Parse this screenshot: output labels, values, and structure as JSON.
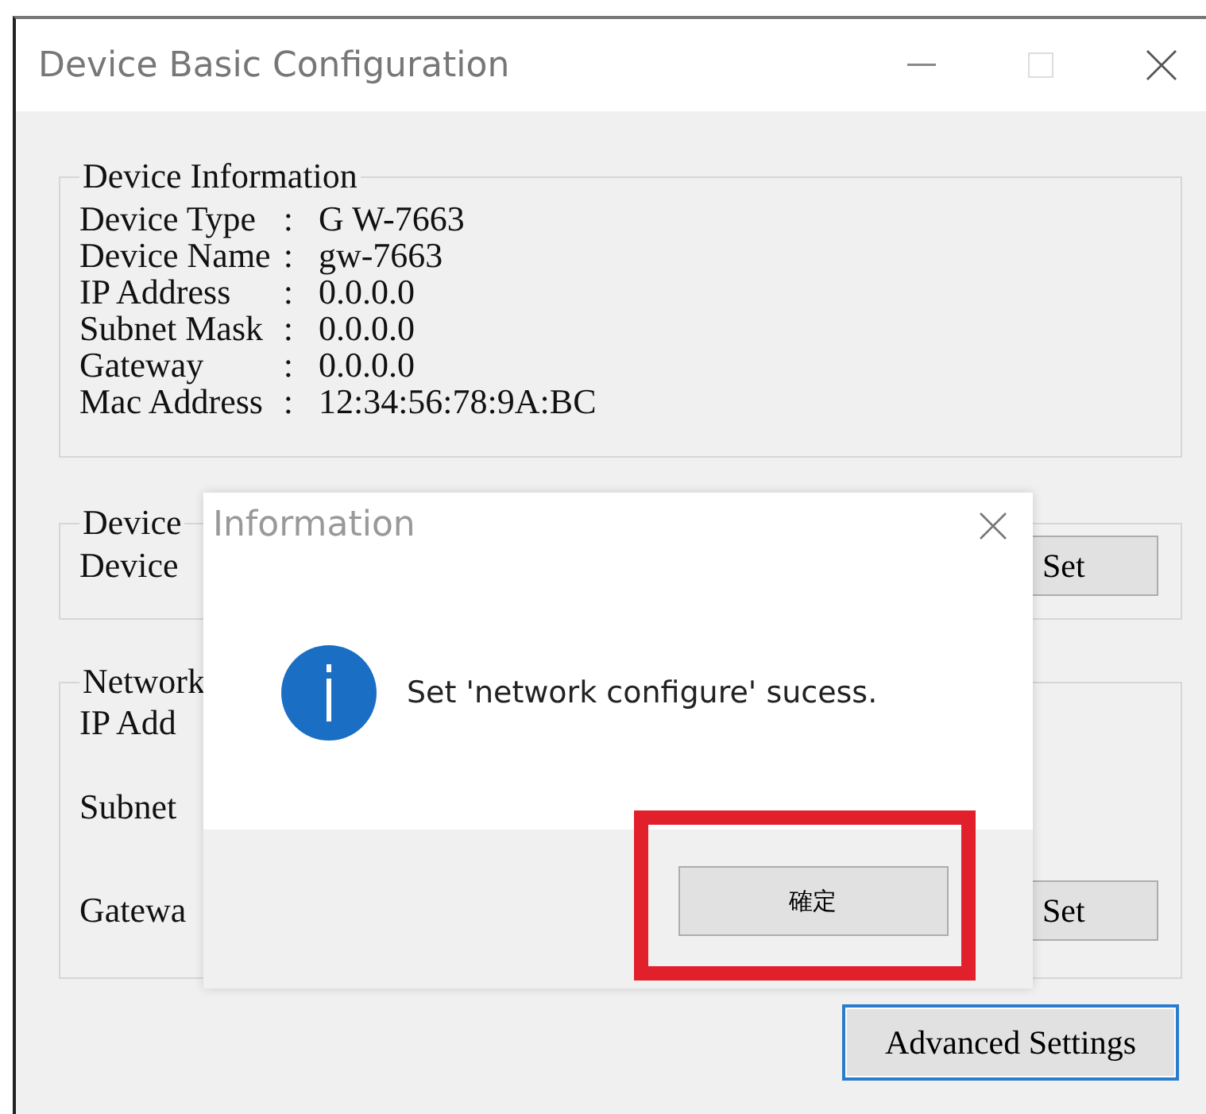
{
  "window": {
    "title": "Device Basic Configuration"
  },
  "device_information": {
    "legend": "Device Information",
    "rows": [
      {
        "label": "Device Type",
        "separator": ":",
        "value": "G W-7663"
      },
      {
        "label": "Device Name",
        "separator": ":",
        "value": "gw-7663"
      },
      {
        "label": "IP Address",
        "separator": ":",
        "value": "0.0.0.0"
      },
      {
        "label": "Subnet Mask",
        "separator": ":",
        "value": "0.0.0.0"
      },
      {
        "label": "Gateway",
        "separator": ":",
        "value": "0.0.0.0"
      },
      {
        "label": "Mac Address",
        "separator": ":",
        "value": "12:34:56:78:9A:BC"
      }
    ]
  },
  "device_name_group": {
    "legend": "Device",
    "fields": [
      "Device"
    ],
    "button": "Set"
  },
  "network_group": {
    "legend": "Network",
    "fields": [
      "IP Add",
      "Subnet",
      "Gatewa"
    ],
    "button": "Set"
  },
  "advanced_button": {
    "label": "Advanced Settings",
    "focused": true
  },
  "dialog": {
    "title": "Information",
    "message": "Set 'network configure' sucess.",
    "button": {
      "label": "確定",
      "highlighted": true
    }
  }
}
